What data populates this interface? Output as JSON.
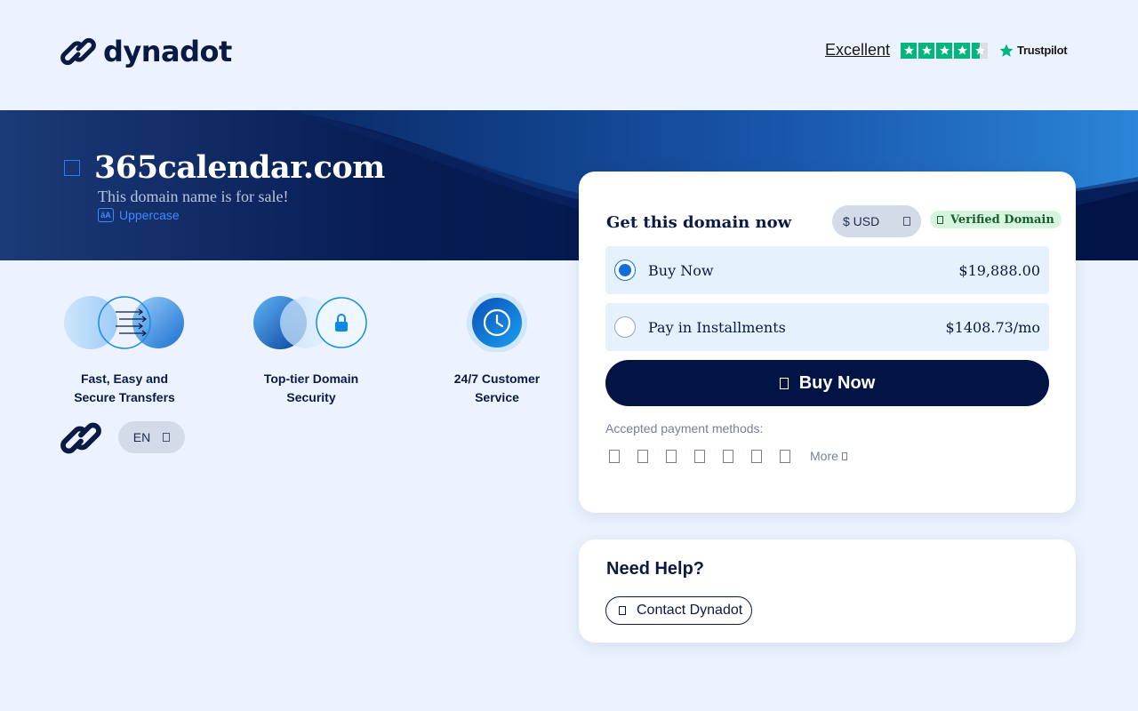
{
  "header": {
    "brand": "dynadot",
    "rating_label": "Excellent",
    "rating_stars": 4.5,
    "trustpilot_label": "Trustpilot"
  },
  "banner": {
    "domain": "365calendar.com",
    "subtitle": "This domain name is for sale!",
    "uppercase_link": "Uppercase"
  },
  "features": [
    {
      "label_line1": "Fast, Easy and",
      "label_line2": "Secure Transfers",
      "icon": "transfer-arrows-icon"
    },
    {
      "label_line1": "Top-tier Domain",
      "label_line2": "Security",
      "icon": "lock-icon"
    },
    {
      "label_line1": "24/7 Customer",
      "label_line2": "Service",
      "icon": "clock-icon"
    }
  ],
  "footer": {
    "language": "EN"
  },
  "purchase": {
    "title": "Get this domain now",
    "currency": "$ USD",
    "verified": "Verified Domain",
    "options": [
      {
        "label": "Buy Now",
        "price": "$19,888.00",
        "selected": true
      },
      {
        "label": "Pay in Installments",
        "price": "$1408.73/mo",
        "selected": false
      }
    ],
    "buy_button": "Buy Now",
    "payment_label": "Accepted payment methods:",
    "more_label": "More"
  },
  "help": {
    "title": "Need Help?",
    "contact_button": "Contact Dynadot"
  },
  "colors": {
    "navy": "#021446",
    "accent_blue": "#1070d8",
    "trustpilot_green": "#00b67a",
    "page_bg": "#ecf3fe"
  }
}
